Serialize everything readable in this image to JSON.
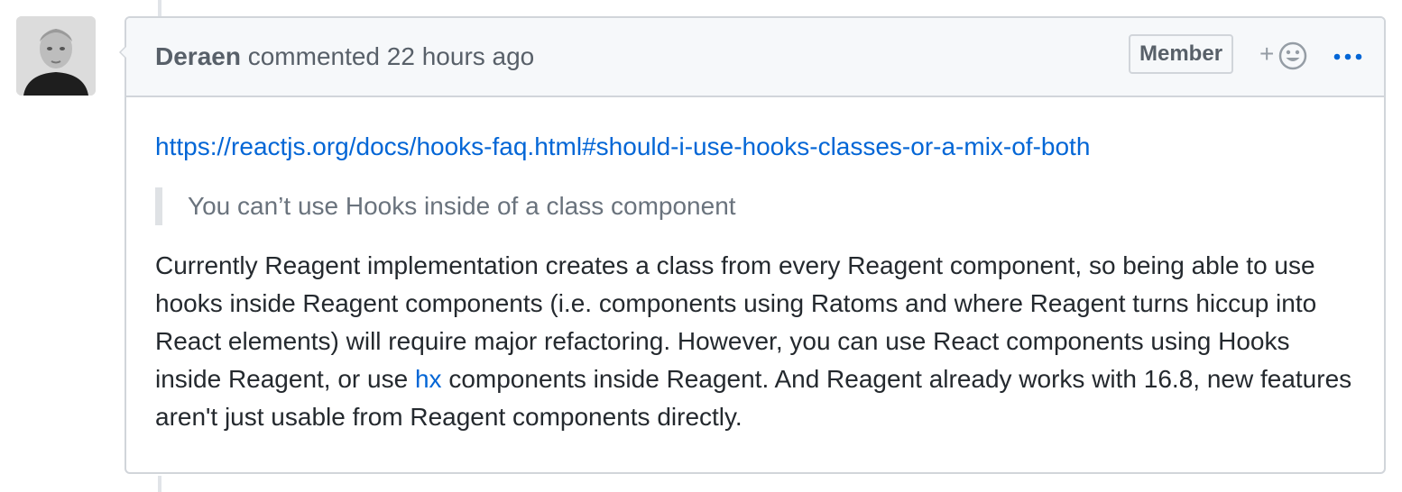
{
  "comment": {
    "author": "Deraen",
    "action_text": " commented ",
    "timestamp": "22 hours ago",
    "badge": "Member",
    "reaction_plus": "+",
    "link_url_text": "https://reactjs.org/docs/hooks-faq.html#should-i-use-hooks-classes-or-a-mix-of-both",
    "quote": "You can’t use Hooks inside of a class component",
    "paragraph_before_link": "Currently Reagent implementation creates a class from every Reagent component, so being able to use hooks inside Reagent components (i.e. components using Ratoms and where Reagent turns hiccup into React elements) will require major refactoring. However, you can use React components using Hooks inside Reagent, or use ",
    "paragraph_link": "hx",
    "paragraph_after_link": " components inside Reagent. And Reagent already works with 16.8, new features aren't just usable from Reagent components directly."
  },
  "icons": {
    "avatar": "avatar",
    "reaction": "smiley-icon",
    "menu": "kebab-horizontal-icon"
  },
  "colors": {
    "link": "#0366d6",
    "header_bg": "#f6f8fa",
    "border": "#d1d5da",
    "muted_text": "#586069",
    "quote_text": "#6a737d"
  }
}
